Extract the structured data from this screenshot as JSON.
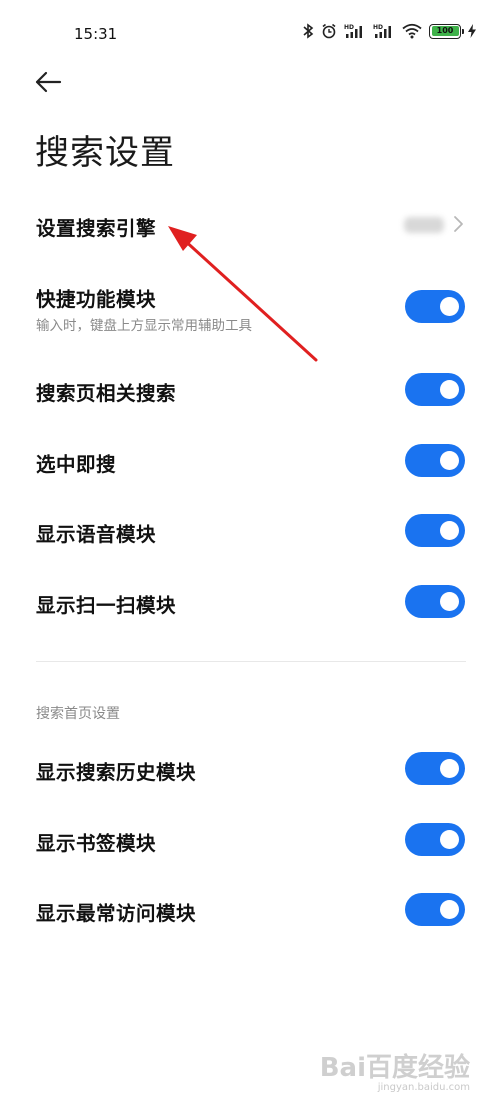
{
  "status_bar": {
    "time": "15:31",
    "battery": "100",
    "icons": [
      "bluetooth-icon",
      "alarm-icon",
      "hd-signal-icon",
      "hd-signal-icon",
      "wifi-icon",
      "battery-icon",
      "charging-icon"
    ]
  },
  "header": {
    "back_icon": "arrow-left-icon",
    "title": "搜索设置"
  },
  "settings": {
    "search_engine": {
      "title": "设置搜索引擎",
      "value_blurred": true
    },
    "quick_function": {
      "title": "快捷功能模块",
      "subtitle": "输入时，键盘上方显示常用辅助工具",
      "enabled": true
    },
    "related_search": {
      "title": "搜索页相关搜索",
      "enabled": true
    },
    "select_search": {
      "title": "选中即搜",
      "enabled": true
    },
    "voice_module": {
      "title": "显示语音模块",
      "enabled": true
    },
    "scan_module": {
      "title": "显示扫一扫模块",
      "enabled": true
    }
  },
  "homepage_section": {
    "header": "搜索首页设置",
    "history_module": {
      "title": "显示搜索历史模块",
      "enabled": true
    },
    "bookmark_module": {
      "title": "显示书签模块",
      "enabled": true
    },
    "frequent_module": {
      "title": "显示最常访问模块",
      "enabled": true
    }
  },
  "colors": {
    "toggle_on": "#1a73f0",
    "annotation_arrow": "#e02020",
    "battery_fill": "#3fb24a"
  },
  "watermark": {
    "brand": "Bai百度经验",
    "url": "jingyan.baidu.com"
  }
}
